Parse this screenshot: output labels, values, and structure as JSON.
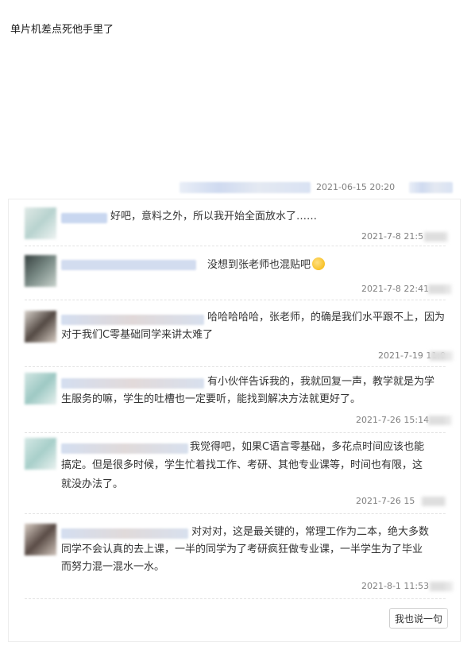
{
  "post": {
    "text": "单片机差点死他手里了"
  },
  "meta": {
    "date": "2021-06-15 20:20"
  },
  "comments": [
    {
      "text_lines": [
        "好吧，意料之外，所以我开始全面放水了……"
      ],
      "date": "2021-7-8 21:5"
    },
    {
      "text_lines": [
        "没想到张老师也混贴吧"
      ],
      "date": "2021-7-8 22:41",
      "emoji": "smile-emoji"
    },
    {
      "text_lines": [
        "哈哈哈哈哈，张老师，的确是我们水平跟不上，因为",
        "对于我们C零基础同学来讲太难了"
      ],
      "date": "2021-7-19 11:0"
    },
    {
      "text_lines": [
        "有小伙伴告诉我的，我就回复一声，教学就是为学",
        "生服务的嘛，学生的吐槽也一定要听，能找到解决方法就更好了。"
      ],
      "date": "2021-7-26 15:14"
    },
    {
      "text_lines": [
        "我觉得吧，如果C语言零基础，多花点时间应该也能",
        "搞定。但是很多时候，学生忙着找工作、考研、其他专业课等，时间也有限，这",
        "就没办法了。"
      ],
      "date": "2021-7-26 15"
    },
    {
      "text_lines": [
        "对对对，这是最关键的，常理工作为二本，绝大多数",
        "同学不会认真的去上课，一半的同学为了考研疯狂做专业课，一半学生为了毕业",
        "而努力混一混水一水。"
      ],
      "date": "2021-8-1 11:53"
    }
  ],
  "reply_button": {
    "label": "我也说一句"
  }
}
